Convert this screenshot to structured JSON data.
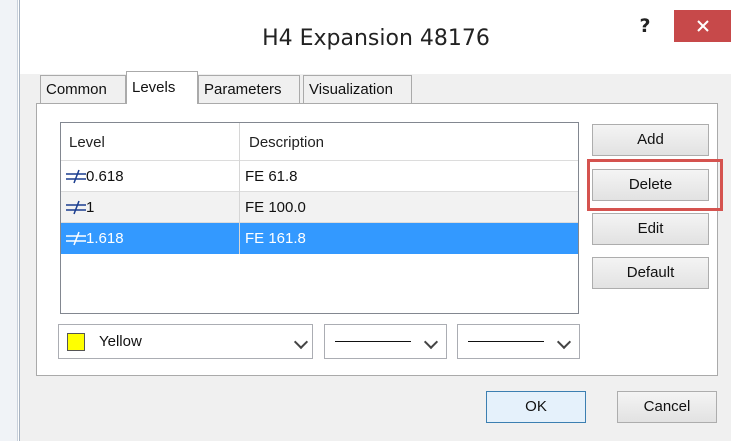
{
  "window": {
    "title": "H4 Expansion 48176",
    "help_label": "?",
    "close_label": "✕"
  },
  "tabs": [
    {
      "label": "Common",
      "active": false
    },
    {
      "label": "Levels",
      "active": true
    },
    {
      "label": "Parameters",
      "active": false
    },
    {
      "label": "Visualization",
      "active": false
    }
  ],
  "table": {
    "columns": [
      "Level",
      "Description"
    ],
    "rows": [
      {
        "level": "0.618",
        "description": "FE 61.8",
        "selected": false
      },
      {
        "level": "1",
        "description": "FE 100.0",
        "selected": false
      },
      {
        "level": "1.618",
        "description": "FE 161.8",
        "selected": true
      }
    ]
  },
  "buttons": {
    "add": "Add",
    "delete": "Delete",
    "edit": "Edit",
    "default": "Default"
  },
  "style": {
    "color_name": "Yellow",
    "color_hex": "#ffff00",
    "line_style": "solid",
    "line_width": "thin"
  },
  "footer": {
    "ok": "OK",
    "cancel": "Cancel"
  },
  "colors": {
    "selection": "#3399ff",
    "close_button": "#c7494a",
    "highlight": "#d5534f"
  }
}
